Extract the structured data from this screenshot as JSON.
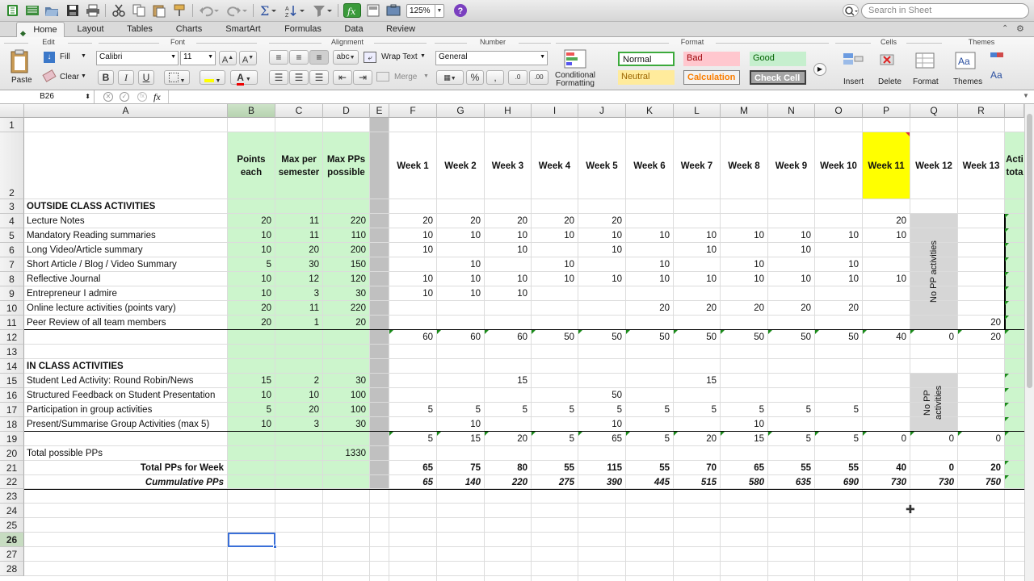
{
  "toolbar": {
    "zoom": "125%",
    "search_placeholder": "Search in Sheet"
  },
  "ribbon_tabs": [
    "Home",
    "Layout",
    "Tables",
    "Charts",
    "SmartArt",
    "Formulas",
    "Data",
    "Review"
  ],
  "ribbon": {
    "groups": {
      "edit": "Edit",
      "font": "Font",
      "alignment": "Alignment",
      "number": "Number",
      "format": "Format",
      "cells": "Cells",
      "themes": "Themes"
    },
    "paste": "Paste",
    "fill": "Fill",
    "clear": "Clear",
    "font_name": "Calibri",
    "font_size": "11",
    "wrap_text": "Wrap Text",
    "merge": "Merge",
    "number_format": "General",
    "conditional_formatting": "Conditional Formatting",
    "styles": {
      "normal": "Normal",
      "bad": "Bad",
      "good": "Good",
      "neutral": "Neutral",
      "calculation": "Calculation",
      "check_cell": "Check Cell"
    },
    "insert": "Insert",
    "delete": "Delete",
    "format": "Format",
    "themes": "Themes"
  },
  "formula_bar": {
    "name_box": "B26",
    "fx": "fx",
    "content": ""
  },
  "grid": {
    "columns": [
      "A",
      "B",
      "C",
      "D",
      "E",
      "F",
      "G",
      "H",
      "I",
      "J",
      "K",
      "L",
      "M",
      "N",
      "O",
      "P",
      "Q",
      "R"
    ],
    "headers": {
      "points_each": "Points each",
      "max_per_semester": "Max per semester",
      "max_pps_possible": "Max PPs possible",
      "weeks": [
        "Week 1",
        "Week 2",
        "Week 3",
        "Week 4",
        "Week 5",
        "Week 6",
        "Week 7",
        "Week 8",
        "Week 9",
        "Week 10",
        "Week 11",
        "Week 12",
        "Week 13"
      ],
      "activity_total": "Acti tota"
    },
    "section_outside": "OUTSIDE CLASS ACTIVITIES",
    "section_inclass": "IN CLASS ACTIVITIES",
    "outside_rows": [
      {
        "label": "Lecture Notes",
        "b": "20",
        "c": "11",
        "d": "220",
        "weeks": [
          "20",
          "20",
          "20",
          "20",
          "20",
          "",
          "",
          "",
          "",
          "",
          "20",
          "",
          ""
        ]
      },
      {
        "label": "Mandatory Reading summaries",
        "b": "10",
        "c": "11",
        "d": "110",
        "weeks": [
          "10",
          "10",
          "10",
          "10",
          "10",
          "10",
          "10",
          "10",
          "10",
          "10",
          "10",
          "",
          ""
        ]
      },
      {
        "label": "Long Video/Article summary",
        "b": "10",
        "c": "20",
        "d": "200",
        "weeks": [
          "10",
          "",
          "10",
          "",
          "10",
          "",
          "10",
          "",
          "10",
          "",
          "",
          "",
          ""
        ]
      },
      {
        "label": "Short Article / Blog / Video Summary",
        "b": "5",
        "c": "30",
        "d": "150",
        "weeks": [
          "",
          "10",
          "",
          "10",
          "",
          "10",
          "",
          "10",
          "",
          "10",
          "",
          "",
          ""
        ]
      },
      {
        "label": "Reflective Journal",
        "b": "10",
        "c": "12",
        "d": "120",
        "weeks": [
          "10",
          "10",
          "10",
          "10",
          "10",
          "10",
          "10",
          "10",
          "10",
          "10",
          "10",
          "",
          ""
        ]
      },
      {
        "label": "Entrepreneur I admire",
        "b": "10",
        "c": "3",
        "d": "30",
        "weeks": [
          "10",
          "10",
          "10",
          "",
          "",
          "",
          "",
          "",
          "",
          "",
          "",
          "",
          ""
        ]
      },
      {
        "label": "Online lecture activities (points vary)",
        "b": "20",
        "c": "11",
        "d": "220",
        "weeks": [
          "",
          "",
          "",
          "",
          "",
          "20",
          "20",
          "20",
          "20",
          "20",
          "",
          "",
          ""
        ]
      },
      {
        "label": "Peer Review of all team members",
        "b": "20",
        "c": "1",
        "d": "20",
        "weeks": [
          "",
          "",
          "",
          "",
          "",
          "",
          "",
          "",
          "",
          "",
          "",
          "",
          "20"
        ]
      }
    ],
    "outside_totals": [
      "60",
      "60",
      "60",
      "50",
      "50",
      "50",
      "50",
      "50",
      "50",
      "50",
      "40",
      "0",
      "20"
    ],
    "inclass_rows": [
      {
        "label": "Student Led Activity: Round Robin/News",
        "b": "15",
        "c": "2",
        "d": "30",
        "weeks": [
          "",
          "",
          "15",
          "",
          "",
          "",
          "15",
          "",
          "",
          "",
          "",
          "",
          ""
        ]
      },
      {
        "label": "Structured Feedback on Student Presentation",
        "b": "10",
        "c": "10",
        "d": "100",
        "weeks": [
          "",
          "",
          "",
          "",
          "50",
          "",
          "",
          "",
          "",
          "",
          "",
          "",
          ""
        ]
      },
      {
        "label": "Participation in group activities",
        "b": "5",
        "c": "20",
        "d": "100",
        "weeks": [
          "5",
          "5",
          "5",
          "5",
          "5",
          "5",
          "5",
          "5",
          "5",
          "5",
          "",
          "",
          ""
        ]
      },
      {
        "label": "Present/Summarise Group Activities (max 5)",
        "b": "10",
        "c": "3",
        "d": "30",
        "weeks": [
          "",
          "10",
          "",
          "",
          "10",
          "",
          "",
          "10",
          "",
          "",
          "",
          "",
          ""
        ]
      }
    ],
    "inclass_totals": [
      "5",
      "15",
      "20",
      "5",
      "65",
      "5",
      "20",
      "15",
      "5",
      "5",
      "0",
      "0",
      "0"
    ],
    "total_possible_label": "Total possible PPs",
    "total_possible_value": "1330",
    "total_week_label": "Total PPs for Week",
    "total_week": [
      "65",
      "75",
      "80",
      "55",
      "115",
      "55",
      "70",
      "65",
      "55",
      "55",
      "40",
      "0",
      "20"
    ],
    "cumulative_label": "Cummulative PPs",
    "cumulative": [
      "65",
      "140",
      "220",
      "275",
      "390",
      "445",
      "515",
      "580",
      "635",
      "690",
      "730",
      "730",
      "750"
    ],
    "no_pp_outside": "No PP activities",
    "no_pp_inclass": "No PP activities",
    "row_numbers": [
      "1",
      "2",
      "3",
      "4",
      "5",
      "6",
      "7",
      "8",
      "9",
      "10",
      "11",
      "12",
      "13",
      "14",
      "15",
      "16",
      "17",
      "18",
      "19",
      "20",
      "21",
      "22",
      "23",
      "24",
      "25",
      "26",
      "27",
      "28"
    ],
    "selected_cell": "B26",
    "colors": {
      "green_fill": "#ccf5cc",
      "week11_fill": "#ffff00",
      "grey_col": "#c0c0c0",
      "no_pp_fill": "#d6d6d6"
    }
  }
}
